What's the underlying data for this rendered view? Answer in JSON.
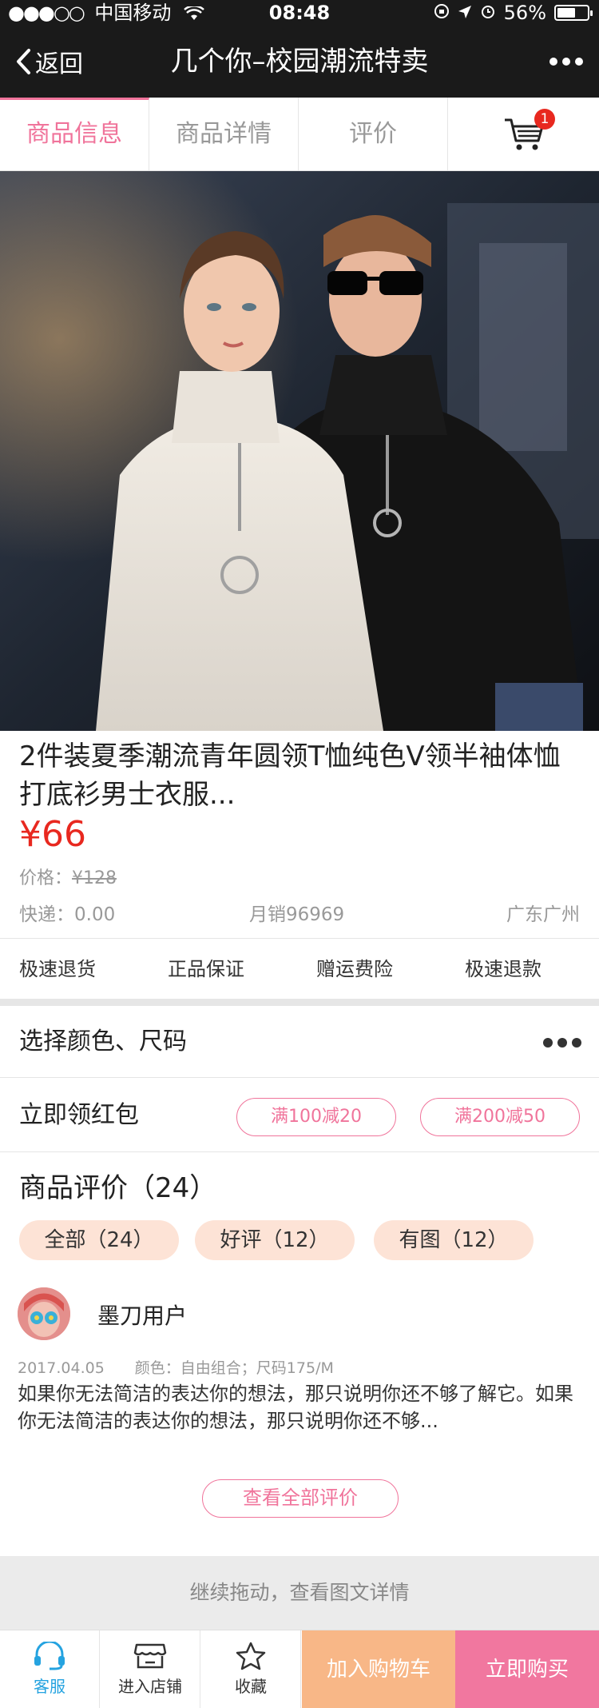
{
  "status_bar": {
    "carrier": "中国移动",
    "time": "08:48",
    "battery": "56%"
  },
  "nav": {
    "back_label": "返回",
    "title": "几个你–校园潮流特卖"
  },
  "tabs": [
    {
      "label": "商品信息"
    },
    {
      "label": "商品详情"
    },
    {
      "label": "评价"
    }
  ],
  "cart": {
    "badge_count": "1"
  },
  "product": {
    "title": "2件装夏季潮流青年圆领T恤纯色V领半袖体恤打底衫男士衣服...",
    "price": "¥66",
    "orig_price_label": "价格：",
    "orig_price": "¥128",
    "shipping": "快递：0.00",
    "monthly_sales": "月销96969",
    "location": "广东广州"
  },
  "guarantees": [
    "极速退货",
    "正品保证",
    "赠运费险",
    "极速退款"
  ],
  "select_options": {
    "label": "选择颜色、尺码"
  },
  "coupons": {
    "label": "立即领红包",
    "items": [
      "满100减20",
      "满200减50"
    ]
  },
  "reviews": {
    "title": "商品评价（24）",
    "filters": [
      "全部（24）",
      "好评（12）",
      "有图（12）"
    ],
    "first": {
      "username": "墨刀用户",
      "date": "2017.04.05",
      "spec": "颜色：自由组合；尺码175/M",
      "text": "如果你无法简洁的表达你的想法，那只说明你还不够了解它。如果你无法简洁的表达你的想法，那只说明你还不够..."
    },
    "see_all_label": "查看全部评价"
  },
  "drag_hint": "继续拖动，查看图文详情",
  "bottom_bar": {
    "service": "客服",
    "store": "进入店铺",
    "favorite": "收藏",
    "add_to_cart": "加入购物车",
    "buy_now": "立即购买"
  },
  "colors": {
    "accent_pink": "#f0749b",
    "price_red": "#e8281f",
    "service_blue": "#25a3e0",
    "cart_orange": "#f8b787",
    "buy_pink": "#f1779f"
  }
}
